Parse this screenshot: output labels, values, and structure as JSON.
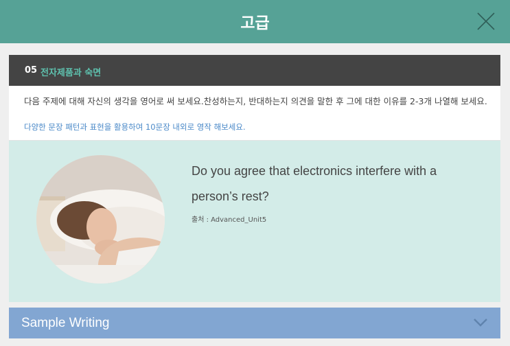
{
  "header": {
    "title": "고급"
  },
  "lesson": {
    "number": "05",
    "title": "전자제품과 숙면"
  },
  "instructions": {
    "main": "다음 주제에 대해 자신의 생각을 영어로 써 보세요.찬성하는지, 반대하는지 의견을 말한 후 그에 대한 이유를 2-3개 나열해 보세요.",
    "sub": "다양한 문장 패턴과 표현을 활용하여 10문장 내외로 영작 해보세요."
  },
  "prompt": {
    "question": "Do you agree that electronics interfere with a person’s rest?",
    "source": "출처 : Advanced_Unit5"
  },
  "sample": {
    "label": "Sample Writing"
  }
}
